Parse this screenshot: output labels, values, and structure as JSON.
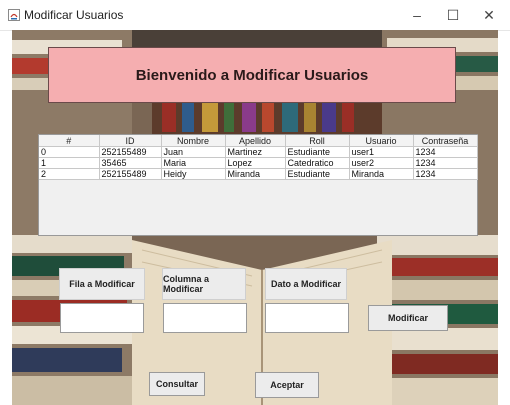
{
  "window": {
    "title": "Modificar Usuarios",
    "minimize": "–",
    "maximize": "☐",
    "close": "✕"
  },
  "banner": {
    "text": "Bienvenido a Modificar Usuarios"
  },
  "table": {
    "headers": [
      "#",
      "ID",
      "Nombre",
      "Apellido",
      "Roll",
      "Usuario",
      "Contraseña"
    ],
    "rows": [
      [
        "0",
        "252155489",
        "Juan",
        "Martinez",
        "Estudiante",
        "user1",
        "1234"
      ],
      [
        "1",
        "35465",
        "Maria",
        "Lopez",
        "Catedratico",
        "user2",
        "1234"
      ],
      [
        "2",
        "252155489",
        "Heidy",
        "Miranda",
        "Estudiante",
        "Miranda",
        "1234"
      ]
    ]
  },
  "labels": {
    "fila": "Fila a Modificar",
    "columna": "Columna a Modificar",
    "dato": "Dato a Modificar"
  },
  "inputs": {
    "fila": "",
    "columna": "",
    "dato": ""
  },
  "buttons": {
    "modificar": "Modificar",
    "consultar": "Consultar",
    "aceptar": "Aceptar"
  }
}
